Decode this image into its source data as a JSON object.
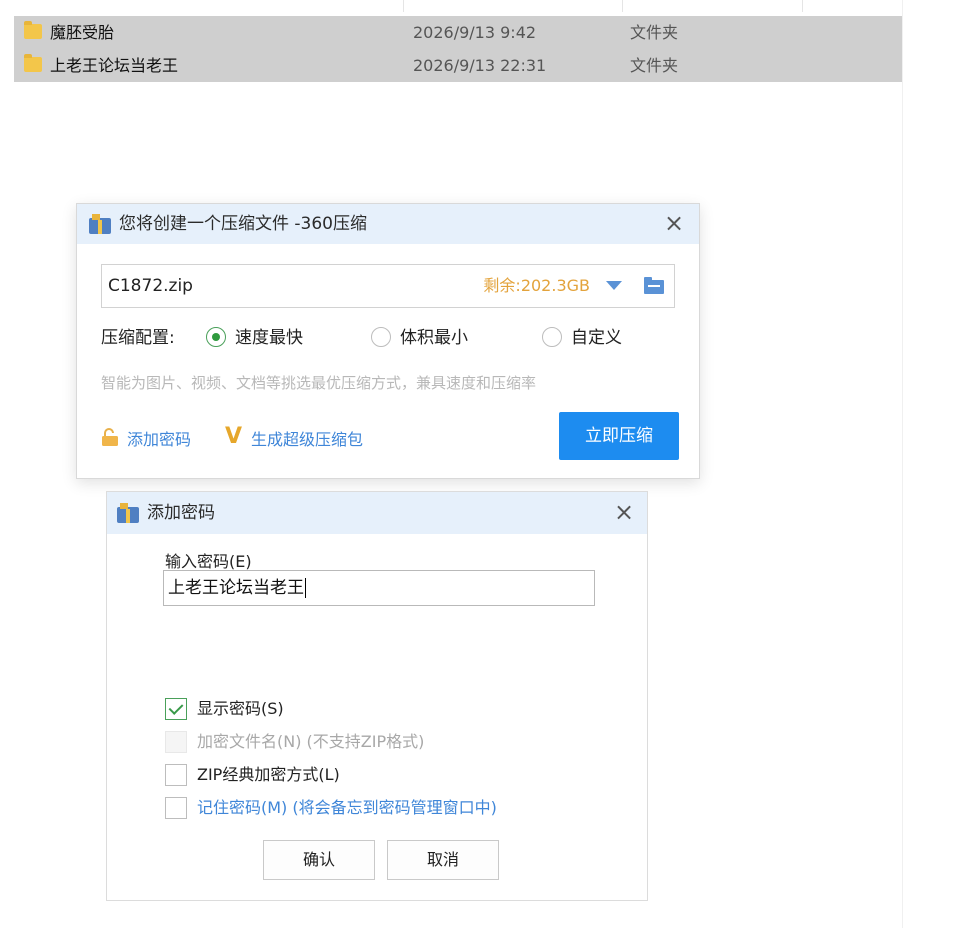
{
  "explorer": {
    "files": [
      {
        "name": "魔胚受胎",
        "date": "2026/9/13 9:42",
        "type": "文件夹",
        "icon": "folder-icon"
      },
      {
        "name": "上老王论坛当老王",
        "date": "2026/9/13 22:31",
        "type": "文件夹",
        "icon": "folder-icon"
      }
    ]
  },
  "compress_dialog": {
    "title": "您将创建一个压缩文件 -360压缩",
    "close_icon": "×",
    "filename": "C1872.zip",
    "free_space": "剩余:202.3GB",
    "config_label": "压缩配置:",
    "options": [
      {
        "label": "速度最快",
        "checked": true
      },
      {
        "label": "体积最小",
        "checked": false
      },
      {
        "label": "自定义",
        "checked": false
      }
    ],
    "hint": "智能为图片、视频、文档等挑选最优压缩方式，兼具速度和压缩率",
    "add_password_label": "添加密码",
    "super_package_icon": "V",
    "super_package_label": "生成超级压缩包",
    "compress_button": "立即压缩",
    "colors": {
      "accent": "#1d8cf0",
      "free_space": "#e3a33c",
      "link": "#3f86d8"
    }
  },
  "password_dialog": {
    "title": "添加密码",
    "close_icon": "×",
    "input_label": "输入密码(E)",
    "input_value": "上老王论坛当老王",
    "checkboxes": [
      {
        "label": "显示密码(S)",
        "checked": true,
        "disabled": false,
        "link": false
      },
      {
        "label": "加密文件名(N) (不支持ZIP格式)",
        "checked": false,
        "disabled": true,
        "link": false
      },
      {
        "label": "ZIP经典加密方式(L)",
        "checked": false,
        "disabled": false,
        "link": false
      },
      {
        "label": "记住密码(M) (将会备忘到密码管理窗口中)",
        "checked": false,
        "disabled": false,
        "link": true
      }
    ],
    "ok_button": "确认",
    "cancel_button": "取消"
  }
}
